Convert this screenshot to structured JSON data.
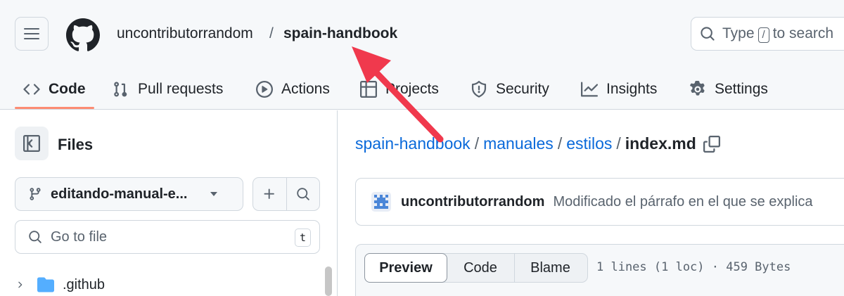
{
  "header": {
    "owner": "uncontributorrandom",
    "separator": "/",
    "repo": "spain-handbook",
    "search": {
      "prefix": "Type",
      "key": "/",
      "suffix": "to search"
    }
  },
  "tabs": [
    {
      "label": "Code",
      "icon": "code-icon",
      "active": true
    },
    {
      "label": "Pull requests",
      "icon": "git-pull-request-icon"
    },
    {
      "label": "Actions",
      "icon": "play-icon"
    },
    {
      "label": "Projects",
      "icon": "table-icon"
    },
    {
      "label": "Security",
      "icon": "shield-icon"
    },
    {
      "label": "Insights",
      "icon": "graph-icon"
    },
    {
      "label": "Settings",
      "icon": "gear-icon"
    }
  ],
  "sidebar": {
    "title": "Files",
    "branch": "editando-manual-e...",
    "goto_placeholder": "Go to file",
    "goto_key": "t",
    "tree": [
      {
        "name": ".github",
        "type": "folder"
      }
    ]
  },
  "main": {
    "path": [
      {
        "label": "spain-handbook",
        "sep": "/"
      },
      {
        "label": "manuales",
        "sep": "/"
      },
      {
        "label": "estilos",
        "sep": "/"
      }
    ],
    "current_file": "index.md",
    "commit": {
      "author": "uncontributorrandom",
      "message": "Modificado el párrafo en el que se explica"
    },
    "view_tabs": [
      {
        "label": "Preview",
        "active": true
      },
      {
        "label": "Code"
      },
      {
        "label": "Blame"
      }
    ],
    "file_meta": "1 lines (1 loc) · 459 Bytes"
  },
  "colors": {
    "accent_underline": "#fd8c73",
    "link": "#0969da",
    "annotation_arrow": "#f0394d"
  }
}
